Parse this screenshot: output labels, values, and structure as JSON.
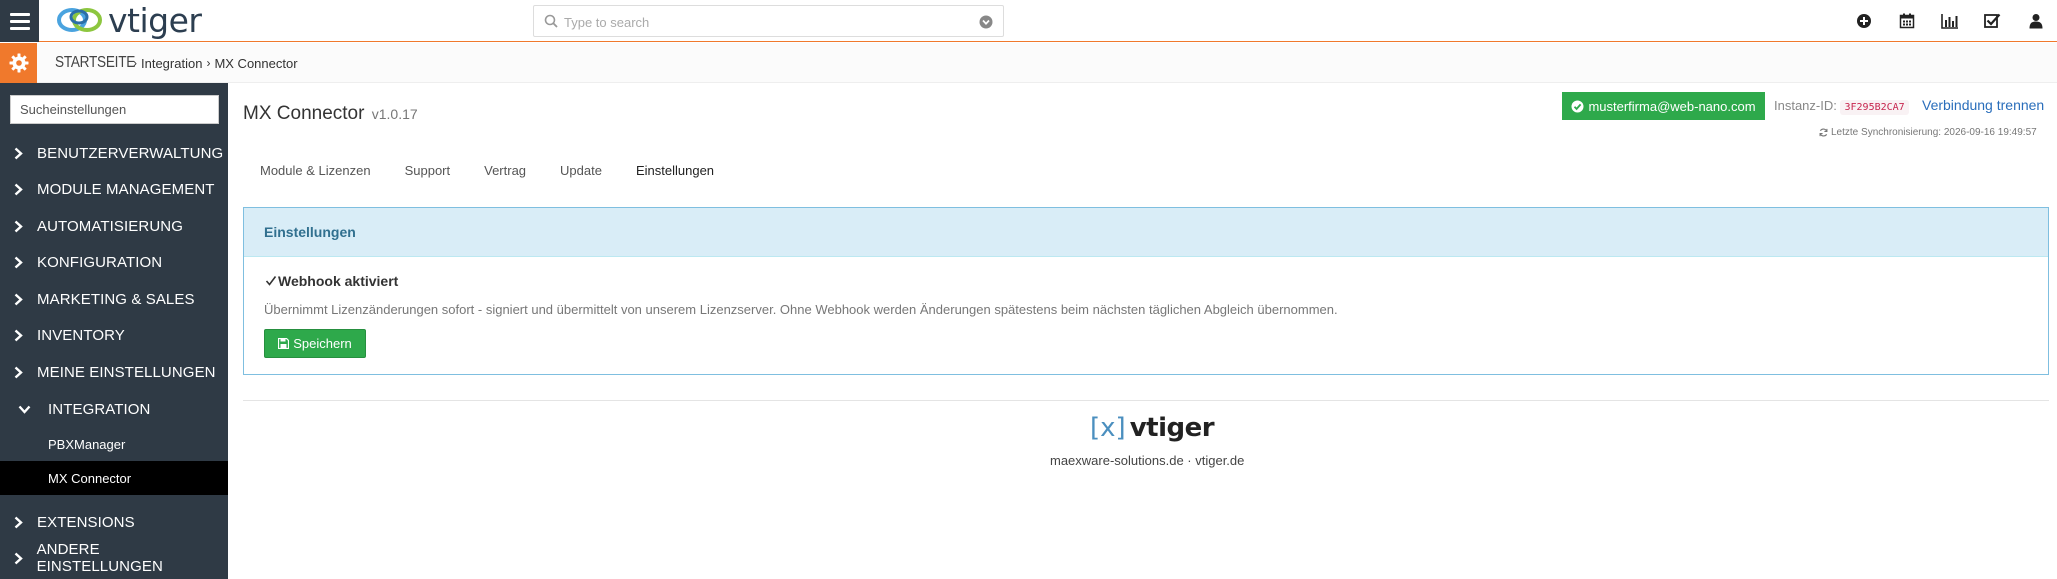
{
  "app": {
    "logo_text": "vtiger",
    "search_placeholder": "Type to search"
  },
  "topbar_icons": [
    "plus-circle-icon",
    "calendar-icon",
    "bar-chart-icon",
    "checkbox-icon",
    "user-icon"
  ],
  "breadcrumb": {
    "home": "STARTSEITE",
    "level1": "Integration",
    "level2": "MX Connector"
  },
  "sidebar": {
    "search_placeholder": "Sucheinstellungen",
    "items": [
      {
        "label": "BENUTZERVERWALTUNG"
      },
      {
        "label": "MODULE MANAGEMENT"
      },
      {
        "label": "AUTOMATISIERUNG"
      },
      {
        "label": "KONFIGURATION"
      },
      {
        "label": "MARKETING & SALES"
      },
      {
        "label": "INVENTORY"
      },
      {
        "label": "MEINE EINSTELLUNGEN"
      },
      {
        "label": "INTEGRATION"
      },
      {
        "label": "EXTENSIONS"
      },
      {
        "label": "ANDERE EINSTELLUNGEN"
      }
    ],
    "subitems": [
      {
        "label": "PBXManager"
      },
      {
        "label": "MX Connector"
      }
    ]
  },
  "main": {
    "title": "MX Connector",
    "version": "v1.0.17",
    "account": "musterfirma@web-nano.com",
    "instanz_label": "Instanz-ID:",
    "instanz_id": "3F295B2CA7",
    "disconnect_label": "Verbindung trennen",
    "sync_text": "Letzte Synchronisierung: 2026-09-16 19:49:57",
    "tabs": [
      {
        "label": "Module & Lizenzen"
      },
      {
        "label": "Support"
      },
      {
        "label": "Vertrag"
      },
      {
        "label": "Update"
      },
      {
        "label": "Einstellungen"
      }
    ],
    "panel": {
      "heading": "Einstellungen",
      "checkbox_label": "Webhook aktiviert",
      "checkbox_checked": true,
      "description": "Übernimmt Lizenzänderungen sofort - signiert und übermittelt von unserem Lizenzserver. Ohne Webhook werden Änderungen spätestens beim nächsten täglichen Abgleich übernommen.",
      "save_label": "Speichern"
    },
    "footer": {
      "logo_bracket": "[x]",
      "logo_text": "vtiger",
      "links": "maexware-solutions.de · vtiger.de"
    }
  },
  "colors": {
    "sidebar_bg": "#2f3a45",
    "accent_orange": "#f0792c",
    "success_green": "#2ea94b",
    "link_blue": "#2a6ebb",
    "panel_head_bg": "#d9edf7"
  }
}
